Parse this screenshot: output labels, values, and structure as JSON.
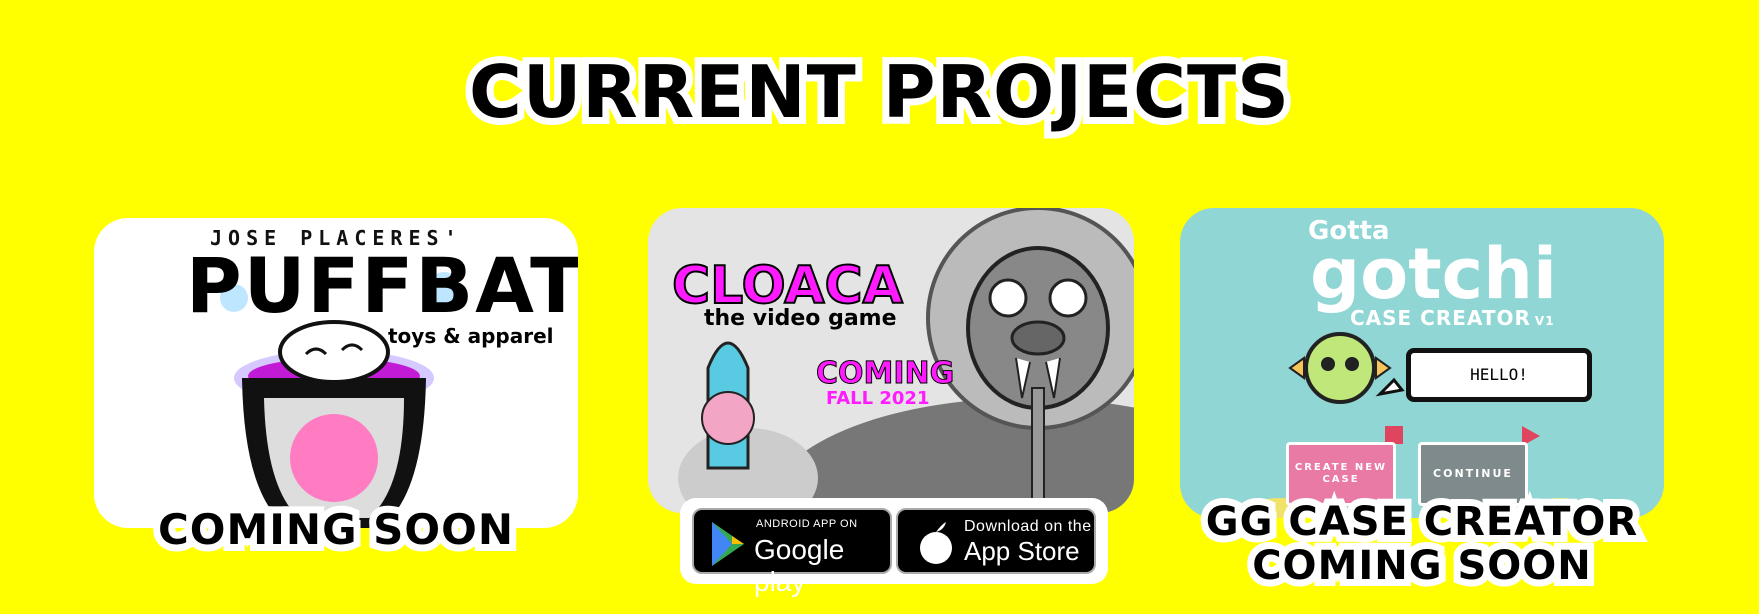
{
  "heading": "CURRENT PROJECTS",
  "projects": [
    {
      "brand_top": "JOSE PLACERES'",
      "logo": "PUFFBAT",
      "subtitle": "toys & apparel",
      "caption": "COMING SOON"
    },
    {
      "logo": "CLOACA",
      "subtitle": "the video game",
      "badge_line1": "COMING",
      "badge_line2": "FALL 2021",
      "stores": {
        "google_small": "ANDROID APP ON",
        "google_big": "Google play",
        "apple_small": "Download on the",
        "apple_big": "App Store"
      }
    },
    {
      "logo_top": "Gotta",
      "logo": "gotchi",
      "subtitle": "CASE CREATOR",
      "version": "V1",
      "speech": "HELLO!",
      "create_button": "CREATE NEW CASE",
      "continue_button": "CONTINUE",
      "caption_line1": "GG CASE CREATOR",
      "caption_line2": "COMING SOON"
    }
  ],
  "colors": {
    "background": "#FFFF00",
    "accent_pink": "#ff1aff",
    "teal": "#8fd6d4"
  }
}
